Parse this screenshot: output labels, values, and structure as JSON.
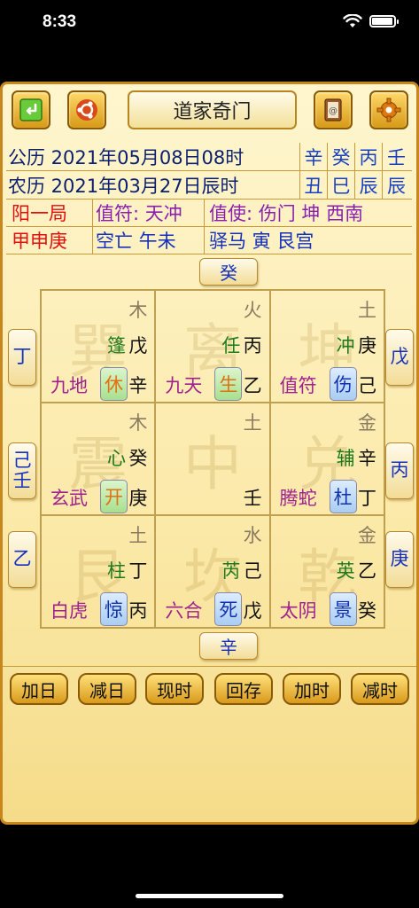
{
  "status": {
    "time": "8:33"
  },
  "toolbar": {
    "title": "道家奇门",
    "back_icon": "back-arrow-icon",
    "theme_icon": "ubuntu-icon",
    "book_icon": "contacts-book-icon",
    "settings_icon": "gear-icon"
  },
  "info": {
    "gregorian": "公历 2021年05月08日08时",
    "lunar": "农历 2021年03月27日辰时",
    "gz_row1": [
      "辛",
      "癸",
      "丙",
      "壬"
    ],
    "gz_row2": [
      "丑",
      "巳",
      "辰",
      "辰"
    ],
    "ju": "阳一局",
    "zhifu": "值符: 天冲",
    "zhishi": "值使: 伤门 坤 西南",
    "xun": "甲申庚",
    "kongwang": "空亡 午未",
    "yima": "驿马 寅 艮宫"
  },
  "board": {
    "top": "癸",
    "bottom": "辛",
    "left": [
      "丁",
      "己\n壬",
      "乙"
    ],
    "right": [
      "戊",
      "丙",
      "庚"
    ],
    "palaces": [
      {
        "watermark": "巽",
        "wuxing": "木",
        "star": "篷",
        "tian": "戊",
        "god": "九地",
        "door": "休",
        "di": "辛",
        "door_style": "green"
      },
      {
        "watermark": "离",
        "wuxing": "火",
        "star": "任",
        "tian": "丙",
        "god": "九天",
        "door": "生",
        "di": "乙",
        "door_style": "green"
      },
      {
        "watermark": "坤",
        "wuxing": "土",
        "star": "冲",
        "tian": "庚",
        "god": "值符",
        "door": "伤",
        "di": "己",
        "door_style": "blue"
      },
      {
        "watermark": "震",
        "wuxing": "木",
        "star": "心",
        "tian": "癸",
        "god": "玄武",
        "door": "开",
        "di": "庚",
        "door_style": "green"
      },
      {
        "watermark": "中",
        "wuxing": "土",
        "star": "",
        "tian": "",
        "god": "",
        "door": "",
        "di": "壬",
        "door_style": ""
      },
      {
        "watermark": "兑",
        "wuxing": "金",
        "star": "辅",
        "tian": "辛",
        "god": "腾蛇",
        "door": "杜",
        "di": "丁",
        "door_style": "blue"
      },
      {
        "watermark": "艮",
        "wuxing": "土",
        "star": "柱",
        "tian": "丁",
        "god": "白虎",
        "door": "惊",
        "di": "丙",
        "door_style": "blue"
      },
      {
        "watermark": "坎",
        "wuxing": "水",
        "star": "芮",
        "tian": "己",
        "god": "六合",
        "door": "死",
        "di": "戊",
        "door_style": "blue"
      },
      {
        "watermark": "乾",
        "wuxing": "金",
        "star": "英",
        "tian": "乙",
        "god": "太阴",
        "door": "景",
        "di": "癸",
        "door_style": "blue"
      }
    ]
  },
  "actions": [
    "加日",
    "减日",
    "现时",
    "回存",
    "加时",
    "减时"
  ],
  "colors": {
    "frame": "#c8871c",
    "panel": "#fbe9a8",
    "date_text": "#0b1f70",
    "ganzhi": "#1840c0",
    "ju": "#e01010",
    "god": "#a12090",
    "star": "#1e7a1e"
  }
}
